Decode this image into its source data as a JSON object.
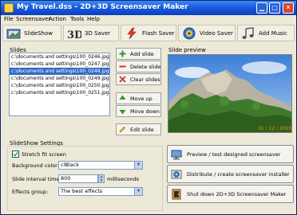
{
  "window": {
    "title": "My Travel.dss - 2D+3D Screensaver Maker",
    "minimize_glyph": "▁",
    "maximize_glyph": "□",
    "close_glyph": "✕"
  },
  "menu": [
    "File",
    "Screensaver",
    "Action",
    "Tools",
    "Help"
  ],
  "toolbar": [
    {
      "label": "SlideShow",
      "icon": "slideshow-icon"
    },
    {
      "label": "3D Saver",
      "icon": "3d-icon"
    },
    {
      "label": "Flash Saver",
      "icon": "flash-icon"
    },
    {
      "label": "Video Saver",
      "icon": "video-icon"
    },
    {
      "label": "Add Music",
      "icon": "music-icon"
    }
  ],
  "slides": {
    "label": "Slides",
    "items": [
      "c:\\documents and settings\\100_0246.jpg",
      "c:\\documents and settings\\100_0247.jpg",
      "c:\\documents and settings\\100_0248.jpg",
      "c:\\documents and settings\\100_0249.jpg",
      "c:\\documents and settings\\100_0250.jpg",
      "c:\\documents and settings\\100_0251.jpg"
    ],
    "selected_index": 2
  },
  "slide_buttons": [
    {
      "label": "Add slide",
      "icon": "plus-icon"
    },
    {
      "label": "Delete slide",
      "icon": "minus-icon"
    },
    {
      "label": "Clear slides",
      "icon": "x-icon"
    },
    {
      "label": "Move up",
      "icon": "up-arrow-icon"
    },
    {
      "label": "Move down",
      "icon": "down-arrow-icon"
    },
    {
      "label": "Edit slide",
      "icon": "pencil-icon"
    }
  ],
  "preview": {
    "label": "Slide preview",
    "date_stamp": "31 / 12 / 2005"
  },
  "settings": {
    "label": "SlideShow Settings",
    "stretch_label": "Stretch fit screen",
    "stretch_checked": true,
    "bg_color_label": "Background color:",
    "bg_color_value": "clBlack",
    "interval_label": "Slide interval time:",
    "interval_value": "800",
    "interval_unit": "milliseconds",
    "effects_label": "Effects group:",
    "effects_value": "The best effects"
  },
  "actions": [
    {
      "label": "Preview / test designed screensaver",
      "icon": "monitor-icon"
    },
    {
      "label": "Distribute / create screensaver installer",
      "icon": "installer-icon"
    },
    {
      "label": "Shut down 2D+3D Screensaver Maker",
      "icon": "shutdown-icon"
    }
  ],
  "colors": {
    "titlebar": "#1d5fe0",
    "selection": "#316ac5",
    "date_stamp": "#ff8a1a"
  }
}
